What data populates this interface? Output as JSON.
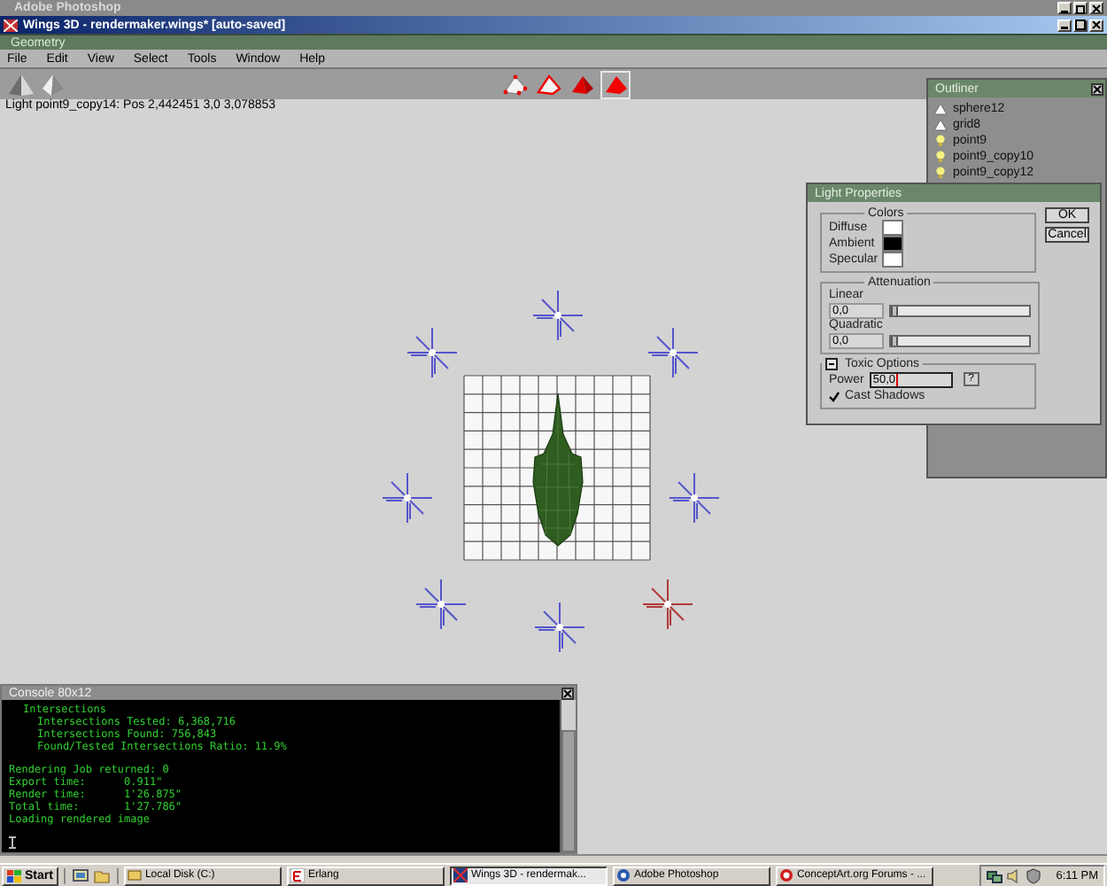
{
  "os_title_bar": {
    "title": "Adobe Photoshop"
  },
  "window": {
    "title": "Wings 3D - rendermaker.wings* [auto-saved]"
  },
  "mode_bar": {
    "label": "Geometry"
  },
  "menu": [
    "File",
    "Edit",
    "View",
    "Select",
    "Tools",
    "Window",
    "Help"
  ],
  "selection_modes": [
    {
      "kind": "vertex",
      "selected": false
    },
    {
      "kind": "edge",
      "selected": false
    },
    {
      "kind": "face",
      "selected": false
    },
    {
      "kind": "body",
      "selected": true
    }
  ],
  "info_line": "Light point9_copy14: Pos 2,442451 3,0 3,078853",
  "lights": [
    {
      "selected": false
    },
    {
      "selected": false
    },
    {
      "selected": false
    },
    {
      "selected": false
    },
    {
      "selected": false
    },
    {
      "selected": false
    },
    {
      "selected": false
    },
    {
      "selected": true
    }
  ],
  "outliner": {
    "title": "Outliner",
    "items": [
      {
        "label": "sphere12",
        "kind": "object"
      },
      {
        "label": "grid8",
        "kind": "object"
      },
      {
        "label": "point9",
        "kind": "light"
      },
      {
        "label": "point9_copy10",
        "kind": "light"
      },
      {
        "label": "point9_copy12",
        "kind": "light"
      }
    ]
  },
  "light_properties": {
    "title": "Light Properties",
    "colors": {
      "legend": "Colors",
      "swatches": [
        {
          "label": "Diffuse",
          "color": "#ffffff"
        },
        {
          "label": "Ambient",
          "color": "#000000"
        },
        {
          "label": "Specular",
          "color": "#ffffff"
        }
      ]
    },
    "attenuation": {
      "legend": "Attenuation",
      "sliders": [
        {
          "label": "Linear",
          "value": "0,0",
          "level": 0
        },
        {
          "label": "Quadratic",
          "value": "0,0",
          "level": 0
        }
      ]
    },
    "toxic_options": {
      "legend": "Toxic Options",
      "expanded": true,
      "power_label": "Power",
      "power_value": "50,0",
      "help": "?",
      "cast_shadows": {
        "label": "Cast Shadows",
        "checked": true
      }
    },
    "buttons": [
      "OK",
      "Cancel"
    ]
  },
  "console": {
    "title": "Console 80x12",
    "blocks": [
      [
        {
          "text": "Intersections",
          "children": [
            {
              "text": "Intersections Tested: 6,368,716"
            },
            {
              "text": "Intersections Found: 756,843"
            },
            {
              "text": "Found/Tested Intersections Ratio: 11.9%"
            }
          ]
        }
      ],
      [
        {
          "text": "Rendering Job returned: 0"
        },
        {
          "text": "Export time:      0.911\""
        },
        {
          "text": "Render time:      1'26.875\""
        },
        {
          "text": "Total time:       1'27.786\""
        },
        {
          "text": "Loading rendered image"
        }
      ]
    ]
  },
  "taskbar": {
    "start": "Start",
    "tasks": [
      {
        "label": "Local Disk (C:)",
        "kind": "folder",
        "selected": false
      },
      {
        "label": "Erlang",
        "kind": "erlang",
        "selected": false
      },
      {
        "label": "Wings 3D - rendermak...",
        "kind": "wings",
        "selected": true
      },
      {
        "label": "Adobe Photoshop",
        "kind": "photoshop",
        "selected": false
      },
      {
        "label": "ConceptArt.org Forums - ...",
        "kind": "browser",
        "selected": false
      }
    ],
    "clock": "6:11 PM"
  }
}
